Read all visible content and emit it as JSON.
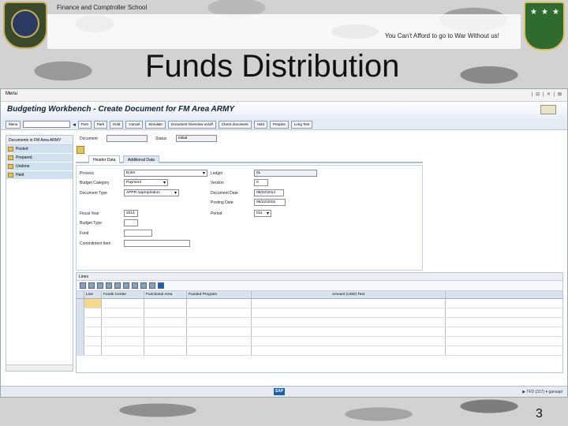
{
  "slide": {
    "header_title": "Finance and Comptroller School",
    "motto": "You Can't Afford to go to War Without us!",
    "title": "Funds Distribution",
    "page_number": "3"
  },
  "sap": {
    "menu_left": "Menu",
    "menu_right": "| ⊟ | ✕ | ⊠",
    "app_title": "Budgeting Workbench - Create Document for FM Area ARMY",
    "toolbar": {
      "menu_button": "Menu",
      "buttons": [
        "Post",
        "Park",
        "Hold",
        "Cancel",
        "Simulate",
        "Document Overview on/off",
        "Check document",
        "Hold",
        "Prepare",
        "Long Text"
      ]
    },
    "tree": {
      "header": "Documents in FM Area ARMY",
      "items": [
        "Posted",
        "Prepared",
        "Undone",
        "Held"
      ]
    },
    "header_fields": {
      "document_label": "Document",
      "status_label": "Status",
      "status_value": "Initial"
    },
    "tabs": [
      "Header Data",
      "Additional Data"
    ],
    "form": {
      "process_label": "Process",
      "process_value": "Enter",
      "budget_category_label": "Budget Category",
      "budget_category_value": "Payment",
      "document_type_label": "Document Type",
      "document_type_value": "APPR Appropriation",
      "ledger_label": "Ledger",
      "ledger_value": "0L",
      "version_label": "Version",
      "version_value": "0",
      "document_date_label": "Document Date",
      "document_date_value": "06/22/2014",
      "posting_date_label": "Posting Date",
      "posting_date_value": "06/22/2015",
      "period_label": "Period",
      "period_value": "011",
      "fiscal_year_label": "Fiscal Year",
      "fiscal_year_value": "2014",
      "budget_type_label": "Budget Type",
      "fund_label": "Fund",
      "commitment_item_label": "Commitment Item"
    },
    "lines": {
      "title": "Lines",
      "columns": [
        "Line",
        "Funds Center",
        "Functional Area",
        "Funded Program",
        "Amount (USD) Text"
      ],
      "row_count_label": ""
    },
    "status": {
      "logo": "SAP",
      "system": "▶ TFD (317) ▾ gansapl"
    }
  }
}
